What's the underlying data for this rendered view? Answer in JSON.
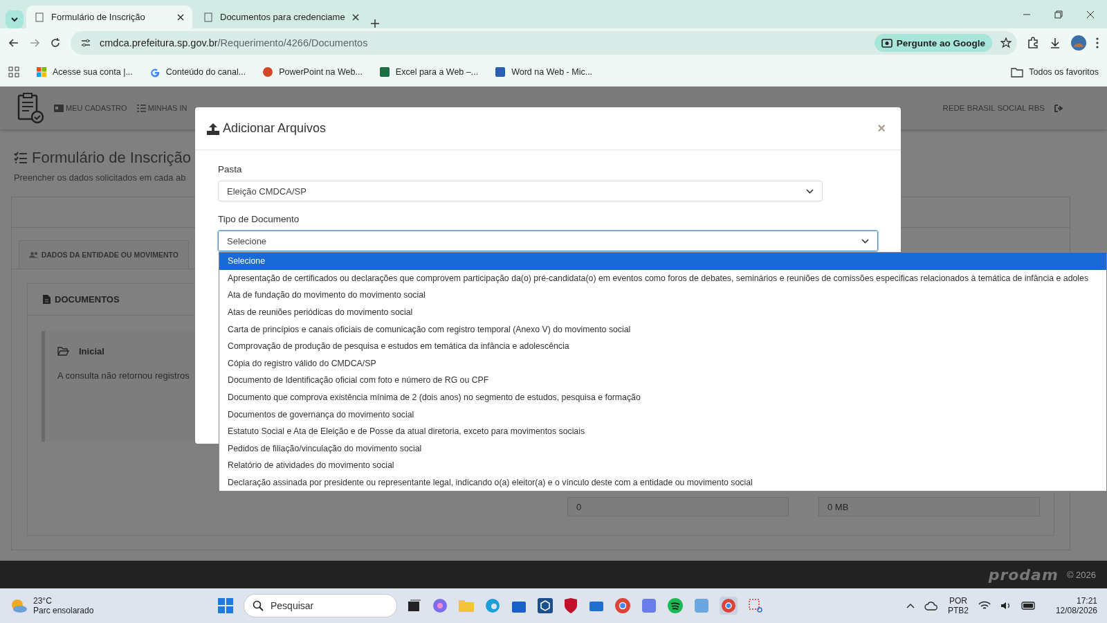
{
  "browser": {
    "tabs": [
      {
        "title": "Formulário de Inscrição",
        "selected": true
      },
      {
        "title": "Documentos para credenciame",
        "selected": false
      }
    ],
    "address": {
      "host": "cmdca.prefeitura.sp.gov.br",
      "path": "/Requerimento/4266/Documentos"
    },
    "google_button": "Pergunte ao Google",
    "bookmarks": [
      {
        "label": "Acesse sua conta |...",
        "kind": "microsoft"
      },
      {
        "label": "Conteúdo do canal...",
        "kind": "google"
      },
      {
        "label": "PowerPoint na Web...",
        "kind": "powerpoint"
      },
      {
        "label": "Excel para a Web –...",
        "kind": "excel"
      },
      {
        "label": "Word na Web - Mic...",
        "kind": "word"
      }
    ],
    "all_bookmarks": "Todos os favoritos"
  },
  "site": {
    "nav": [
      {
        "label": "MEU CADASTRO",
        "kind": "card"
      },
      {
        "label": "MINHAS IN",
        "kind": "list"
      }
    ],
    "user": "REDE BRASIL SOCIAL RBS",
    "title": "Formulário de Inscrição",
    "subtitle": "Preencher os dados solicitados em cada ab",
    "tab": "DADOS DA ENTIDADE OU MOVIMENTO",
    "section": "DOCUMENTOS",
    "folder": {
      "name": "Inicial",
      "message": "A consulta não retornou registros"
    },
    "fields": [
      {
        "value": "0"
      },
      {
        "value": "0 MB"
      }
    ],
    "footer": {
      "logo": "prodam",
      "copyright": "© 2026"
    }
  },
  "modal": {
    "title": "Adicionar Arquivos",
    "close": "×",
    "fields": [
      {
        "label": "Pasta",
        "value": "Eleição CMDCA/SP",
        "open": false
      },
      {
        "label": "Tipo de Documento",
        "value": "Selecione",
        "open": true
      }
    ],
    "options": [
      {
        "label": "Selecione",
        "selected": true
      },
      {
        "label": "Apresentação de certificados ou declarações que comprovem participação da(o) pré-candidata(o) em eventos como foros de debates, seminários e reuniões de comissões especificas relacionados à temática de infância e adoles",
        "selected": false
      },
      {
        "label": "Ata de fundação do movimento do movimento social",
        "selected": false
      },
      {
        "label": "Atas de reuniões periódicas do movimento social",
        "selected": false
      },
      {
        "label": "Carta de princípios e canais oficiais de comunicação com registro temporal (Anexo V) do movimento social",
        "selected": false
      },
      {
        "label": "Comprovação de produção de pesquisa e estudos em temática da infância e adolescência",
        "selected": false
      },
      {
        "label": "Cópia do registro válido do CMDCA/SP",
        "selected": false
      },
      {
        "label": "Documento de Identificação oficial com foto e número de RG ou CPF",
        "selected": false
      },
      {
        "label": "Documento que comprova existência mínima de 2 (dois anos) no segmento de estudos, pesquisa e formação",
        "selected": false
      },
      {
        "label": "Documentos de governança do movimento social",
        "selected": false
      },
      {
        "label": "Estatuto Social e Ata de Eleição e de Posse da atual diretoria, exceto para movimentos sociais",
        "selected": false
      },
      {
        "label": "Pedidos de filiação/vinculação do movimento social",
        "selected": false
      },
      {
        "label": "Relatório de atividades do movimento social",
        "selected": false
      },
      {
        "label": "Declaração assinada por presidente ou representante legal, indicando o(a) eleitor(a) e o vínculo deste com a entidade ou movimento social",
        "selected": false
      }
    ]
  },
  "taskbar": {
    "weather": {
      "temp": "23°C",
      "text": "Parc ensolarado"
    },
    "search": {
      "placeholder": "Pesquisar"
    },
    "language": {
      "code": "POR",
      "layout": "PTB2"
    },
    "time": "17:21",
    "date": "12/08/2026"
  }
}
